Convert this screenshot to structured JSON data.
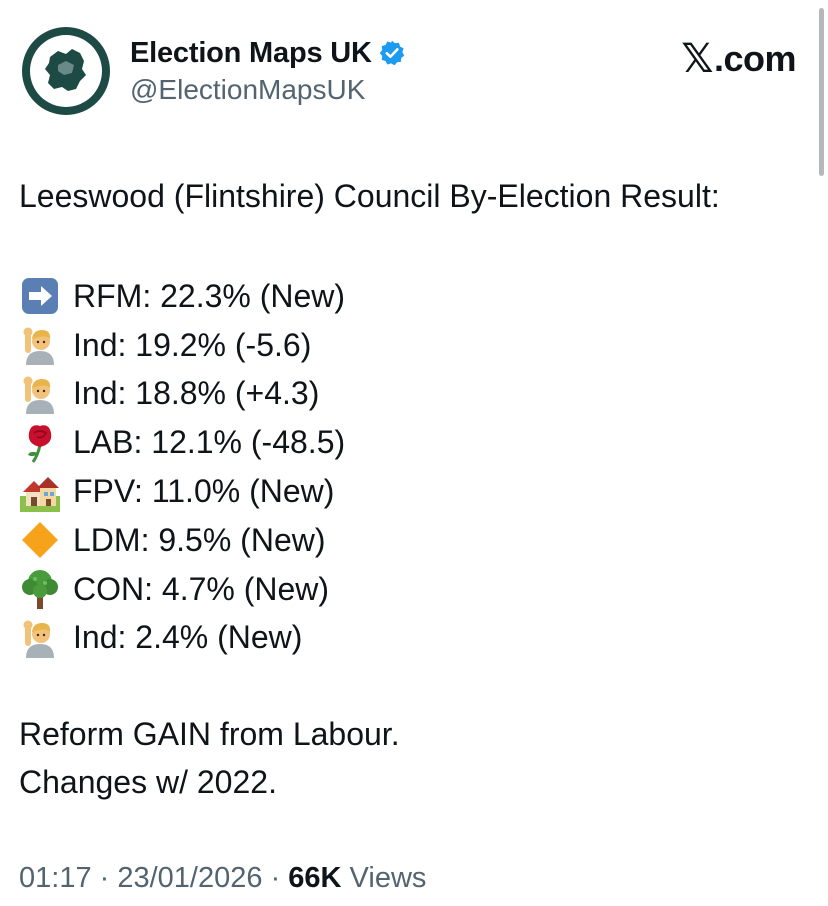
{
  "author": {
    "name": "Election Maps UK",
    "handle": "@ElectionMapsUK",
    "verified_color": "#1d9bf0",
    "avatar_color": "#1d4a45"
  },
  "brand": {
    "x_glyph": "𝕏",
    "suffix": ".com"
  },
  "tweet": {
    "headline": "Leeswood (Flintshire) Council By-Election Result:",
    "results": [
      {
        "icon": "arrow-right-icon",
        "text": "RFM: 22.3% (New)"
      },
      {
        "icon": "person-raising-hand-icon",
        "text": "Ind: 19.2% (-5.6)"
      },
      {
        "icon": "person-raising-hand-icon",
        "text": "Ind: 18.8% (+4.3)"
      },
      {
        "icon": "rose-icon",
        "text": "LAB: 12.1% (-48.5)"
      },
      {
        "icon": "houses-icon",
        "text": "FPV: 11.0% (New)"
      },
      {
        "icon": "orange-diamond-icon",
        "text": "LDM: 9.5% (New)"
      },
      {
        "icon": "tree-icon",
        "text": "CON: 4.7% (New)"
      },
      {
        "icon": "person-raising-hand-icon",
        "text": "Ind: 2.4% (New)"
      }
    ],
    "footer_line_1": "Reform GAIN from Labour.",
    "footer_line_2": "Changes w/ 2022."
  },
  "meta": {
    "time": "01:17",
    "separator": " · ",
    "date": "23/01/2026",
    "views_count": "66K",
    "views_label": " Views"
  }
}
